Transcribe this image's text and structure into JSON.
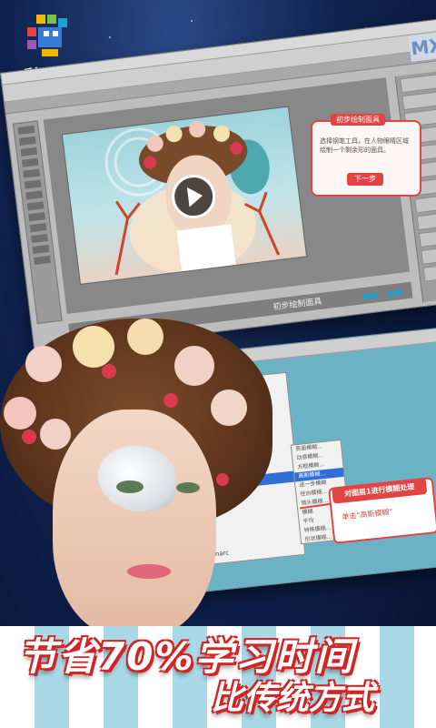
{
  "app": {
    "name": "秒秒学",
    "brand_colors": [
      "#e24444",
      "#1aa3d6"
    ]
  },
  "lesson": {
    "callout_title": "初步绘制面具",
    "callout_body": "选择钢笔工具，在人物眼睛区域绘制一个剩余形的面具。",
    "next_button": "下一步",
    "step_label": "初步绘制面具",
    "logo_mark": "MX"
  },
  "step2": {
    "note_title": "对图层1进行模糊处理",
    "note_body": "单击“高斯模糊”",
    "menu_footer": "Digimarc",
    "submenu_items": [
      "表面模糊...",
      "动感模糊...",
      "方框模糊...",
      "高斯模糊...",
      "进一步模糊",
      "径向模糊...",
      "镜头模糊...",
      "模糊",
      "平均",
      "特殊模糊...",
      "形状模糊..."
    ]
  },
  "promo": {
    "headline": "节省70%学习时间",
    "subline": "比传统方式"
  },
  "icons": [
    "logo-icon",
    "play-icon",
    "rewind-icon",
    "forward-icon"
  ]
}
